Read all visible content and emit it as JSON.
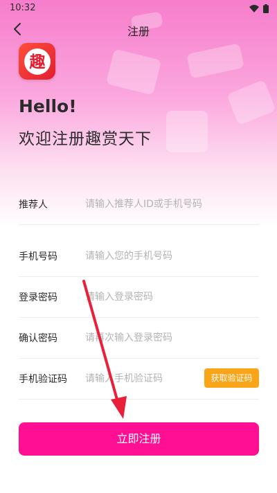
{
  "status_bar": {
    "time": "10:32"
  },
  "nav": {
    "title": "注册"
  },
  "logo": {
    "text": "趣"
  },
  "header": {
    "greeting": "Hello!",
    "welcome": "欢迎注册趣赏天下"
  },
  "form": {
    "fields": [
      {
        "label": "推荐人",
        "placeholder": "请输入推荐人ID或手机号码",
        "value": ""
      },
      {
        "label": "手机号码",
        "placeholder": "请输入您的手机号码",
        "value": ""
      },
      {
        "label": "登录密码",
        "placeholder": "请输入登录密码",
        "value": ""
      },
      {
        "label": "确认密码",
        "placeholder": "请再次输入登录密码",
        "value": ""
      },
      {
        "label": "手机验证码",
        "placeholder": "请输入手机验证码",
        "value": ""
      }
    ],
    "get_code_label": "获取验证码",
    "submit_label": "立即注册"
  },
  "colors": {
    "primary": "#ff0f94",
    "code_button": "#f9a51a",
    "annotation_arrow": "#e8203a"
  }
}
